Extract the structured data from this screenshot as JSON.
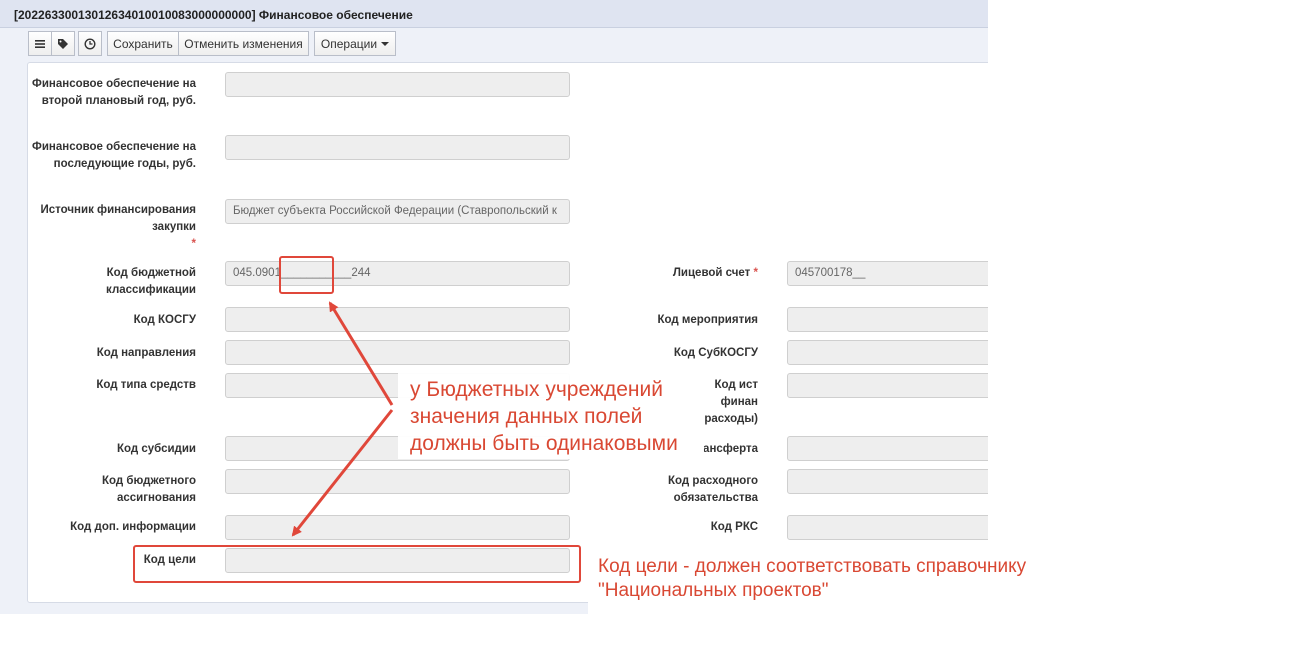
{
  "window": {
    "title": "[20226330013012634010010083000000000] Финансовое обеспечение"
  },
  "toolbar": {
    "menu_icon": "menu-icon",
    "tag_icon": "tag-icon",
    "history_icon": "clock-icon",
    "save_label": "Сохранить",
    "cancel_label": "Отменить изменения",
    "operations_label": "Операции"
  },
  "form": {
    "second_plan_year": {
      "label": "Финансовое обеспечение на второй плановый год, руб.",
      "value": ""
    },
    "following_years": {
      "label": "Финансовое обеспечение на последующие годы, руб.",
      "value": ""
    },
    "funding_source": {
      "label": "Источник финансирования закупки",
      "required": "*",
      "value": "Бюджет субъекта Российской Федерации (Ставропольский к"
    },
    "budget_code": {
      "label": "Код бюджетной классификации",
      "value": "045.0901___________244"
    },
    "personal_account": {
      "label": "Лицевой счет",
      "required": "*",
      "value": "045700178__"
    },
    "kosgu": {
      "label": "Код КОСГУ",
      "value": ""
    },
    "event_code": {
      "label": "Код мероприятия",
      "value": ""
    },
    "direction_code": {
      "label": "Код направления",
      "value": ""
    },
    "sub_kosgu": {
      "label": "Код СубКОСГУ",
      "value": ""
    },
    "funds_type": {
      "label": "Код типа средств",
      "value": ""
    },
    "source_code": {
      "label_visible_top": "Код ист",
      "label_visible_mid1": "финан",
      "label_visible_mid2": "расходы)",
      "value": ""
    },
    "subsidy_code": {
      "label": "Код субсидии",
      "value": ""
    },
    "transfer_code": {
      "label_visible": "ансферта",
      "value": ""
    },
    "budget_allocation": {
      "label": "Код бюджетного ассигнования",
      "value": ""
    },
    "expense_obligation": {
      "label": "Код расходного обязательства",
      "value": ""
    },
    "extra_info": {
      "label": "Код доп. информации",
      "value": ""
    },
    "rks_code": {
      "label": "Код РКС",
      "value": ""
    },
    "goal_code": {
      "label": "Код цели",
      "value": ""
    }
  },
  "annotations": {
    "callout_lines": [
      "у Бюджетных учреждений",
      "значения данных полей",
      "должны быть одинаковыми"
    ],
    "goal_note_lines": [
      "Код цели - должен соответствовать справочнику",
      "\"Национальных проектов\""
    ],
    "accent_color": "#e0473a"
  }
}
